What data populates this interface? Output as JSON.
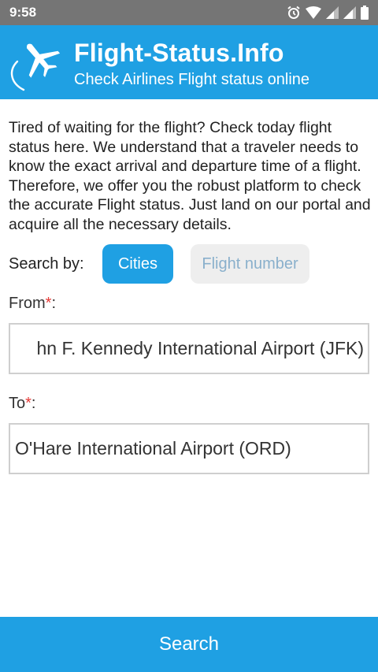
{
  "status_bar": {
    "time": "9:58",
    "icons": [
      "alarm-icon",
      "wifi-icon",
      "cell-signal-icon",
      "cell-signal-icon",
      "battery-icon"
    ]
  },
  "header": {
    "title": "Flight-Status.Info",
    "subtitle": "Check Airlines Flight status online",
    "logo_icon": "airplane-icon",
    "background_color": "#1fa0e3"
  },
  "intro_text": "Tired of waiting for the flight? Check today flight status here. We understand that a traveler needs to know the exact arrival and departure time of a flight. Therefore, we offer you the robust platform to check the accurate Flight status. Just land on our portal and acquire all the necessary details.",
  "search_by": {
    "label": "Search by:",
    "options": [
      {
        "label": "Cities",
        "selected": true
      },
      {
        "label": "Flight number",
        "selected": false
      }
    ]
  },
  "from": {
    "label": "From",
    "required_mark": "*",
    "suffix": ":",
    "value": "hn F. Kennedy International Airport (JFK)"
  },
  "to": {
    "label": "To",
    "required_mark": "*",
    "suffix": ":",
    "value": "O'Hare International Airport (ORD)"
  },
  "search_button": {
    "label": "Search"
  }
}
